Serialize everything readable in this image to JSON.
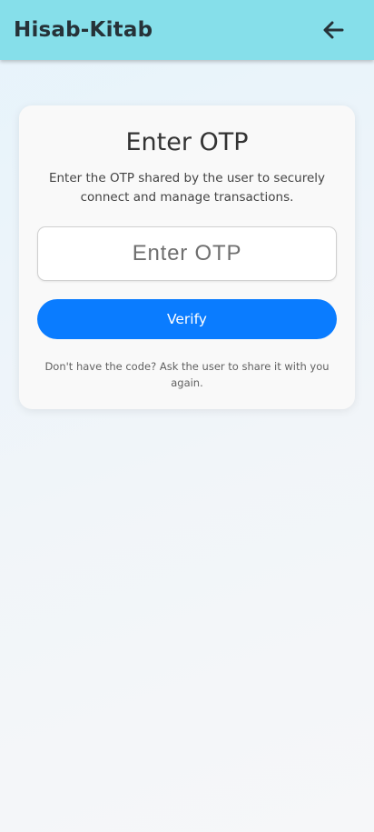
{
  "app_bar": {
    "title": "Hisab-Kitab",
    "back_icon": "arrow-left-icon"
  },
  "otp_card": {
    "title": "Enter OTP",
    "description": "Enter the OTP shared by the user to securely connect and manage transactions.",
    "otp_input": {
      "placeholder": "Enter OTP",
      "value": ""
    },
    "verify_label": "Verify",
    "hint": "Don't have the code? Ask the user to share it with you again."
  },
  "colors": {
    "app_bar": "#86dfea",
    "primary_button": "#0a7cff",
    "card": "#f9f9f9"
  }
}
